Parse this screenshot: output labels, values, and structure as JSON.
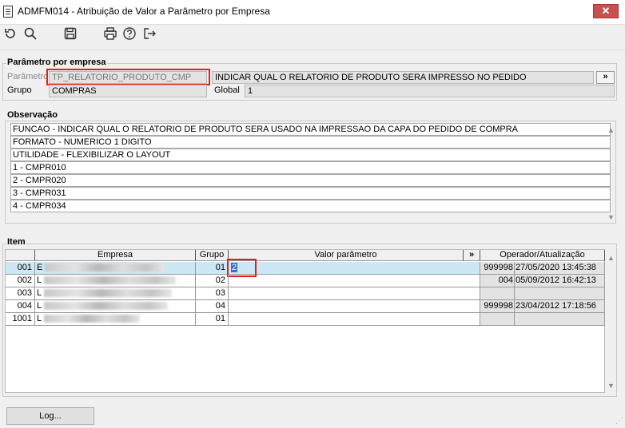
{
  "window": {
    "title": "ADMFM014 - Atribuição de Valor a Parâmetro por Empresa",
    "close_label": "✕"
  },
  "toolbar": {
    "icons": [
      "undo-icon",
      "search-icon",
      "save-icon",
      "print-icon",
      "help-icon",
      "exit-icon"
    ]
  },
  "param_group": {
    "title": "Parâmetro por empresa",
    "param_label": "Parâmetro",
    "param_value": "TP_RELATORIO_PRODUTO_CMP",
    "description": "INDICAR QUAL O RELATORIO DE PRODUTO SERA IMPRESSO NO PEDIDO",
    "more_label": "»",
    "grupo_label": "Grupo",
    "grupo_value": "COMPRAS",
    "global_label": "Global",
    "global_value": "1"
  },
  "observacao": {
    "title": "Observação",
    "lines": [
      "FUNCAO - INDICAR QUAL O RELATORIO DE PRODUTO SERA USADO NA IMPRESSAO DA CAPA DO PEDIDO DE COMPRA",
      "FORMATO - NUMERICO 1 DIGITO",
      "UTILIDADE - FLEXIBILIZAR O LAYOUT",
      "1 - CMPR010",
      "2 - CMPR020",
      "3 - CMPR031",
      "4 - CMPR034"
    ]
  },
  "item": {
    "title": "Item",
    "columns": {
      "empresa": "Empresa",
      "grupo": "Grupo",
      "valor": "Valor parâmetro",
      "more": "»",
      "operador": "Operador/Atualização"
    },
    "rows": [
      {
        "code": "001",
        "empresa_initial": "E",
        "grupo": "01",
        "valor": "2",
        "operador": "999998",
        "data": "27/05/2020 13:45:38",
        "selected": true
      },
      {
        "code": "002",
        "empresa_initial": "L",
        "grupo": "02",
        "valor": "",
        "operador": "004",
        "data": "05/09/2012 16:42:13",
        "selected": false
      },
      {
        "code": "003",
        "empresa_initial": "L",
        "grupo": "03",
        "valor": "",
        "operador": "",
        "data": "",
        "selected": false
      },
      {
        "code": "004",
        "empresa_initial": "L",
        "grupo": "04",
        "valor": "",
        "operador": "999998",
        "data": "23/04/2012 17:18:56",
        "selected": false
      },
      {
        "code": "1001",
        "empresa_initial": "L",
        "grupo": "01",
        "valor": "",
        "operador": "",
        "data": "",
        "selected": false
      }
    ]
  },
  "footer": {
    "log_label": "Log..."
  }
}
